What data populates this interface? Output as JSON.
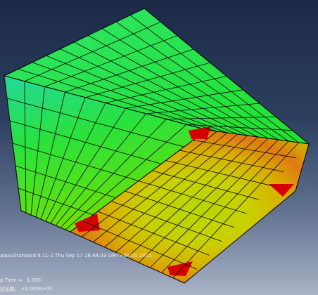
{
  "viewport": {
    "info_line": "aqus/Standard 6.11-2    Thu Sep 17 16:44:33 GMT+08:00 2015",
    "step_time_label": "p Time =",
    "step_time_value": "1.000",
    "factor_label": "放系数:",
    "factor_value": "+1.000e+00"
  },
  "colors": {
    "green": "#20e020",
    "cyan": "#20e0c0",
    "yellow_green": "#a0e000",
    "yellow": "#d8d800",
    "orange": "#e08a18",
    "red": "#d00000",
    "mesh": "#000000"
  }
}
